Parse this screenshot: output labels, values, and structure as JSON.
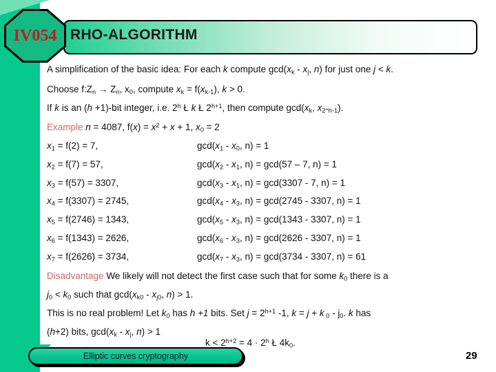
{
  "slide": {
    "course_code": "IV054",
    "title": "RHO-ALGORITHM",
    "page_number": "29",
    "footer_label": "Elliptic curves cryptography",
    "accent_green": "#05c98c",
    "highlight_red": "#c46a6a",
    "code_red": "#cc1a1a"
  },
  "intro": {
    "line1_a": "A simplification of the basic idea: For each ",
    "line1_k": "k",
    "line1_b": " compute gcd(",
    "line1_x": "x",
    "line1_xk_sub": "k",
    "line1_c": " - ",
    "line1_xj": "x",
    "line1_xj_sub": "j",
    "line1_d": ", ",
    "line1_n": "n",
    "line1_e": ") for just one ",
    "line1_j": "j",
    "line1_f": " < ",
    "line1_g": "k",
    "line1_h": "."
  },
  "setup": {
    "line1": "Choose f:Z",
    "line1_sub1": "n",
    "line1_arrow": " → Z",
    "line1_sub2": "n",
    "line1_b": ", x",
    "line1_sub3": "0",
    "line1_c": ", compute ",
    "line1_xk": "x",
    "line1_sub4": "k",
    "line1_d": " = f(",
    "line1_xk1": "x",
    "line1_sub5": "k-1",
    "line1_e": "), ",
    "line1_kk": "k",
    "line1_f": " > 0.",
    "line2_a": "If ",
    "line2_k": "k",
    "line2_b": " is an (",
    "line2_h": "h",
    "line2_c": " +1)-bit integer, i.e. 2",
    "line2_sup1": "h",
    "line2_le1": " Ł ",
    "line2_k2": "k",
    "line2_le2": " Ł ",
    "line2_d": " 2",
    "line2_sup2": "h+1",
    "line2_e": ", then compute gcd(",
    "line2_xk": "x",
    "line2_subk": "k",
    "line2_f": ", ",
    "line2_x2": "x",
    "line2_sub2h": "2^h-1",
    "line2_g": ")."
  },
  "example": {
    "label": "Example",
    "header_a": " n",
    "header_b": " = 4087, f(",
    "header_x": "x",
    "header_c": ") = ",
    "header_x2": "x",
    "header_sup": "2",
    "header_d": " + ",
    "header_x3": "x",
    "header_e": " + 1, ",
    "header_x0": "x",
    "header_sub0": "0",
    "header_f": " = 2",
    "rows": [
      {
        "left_var": "x",
        "left_sub": "1",
        "left_rest": " = f(2) = 7,",
        "right_pre": "gcd(",
        "right_x1": "x",
        "right_sub1": "1",
        "right_mid": " - ",
        "right_x2": "x",
        "right_sub2": "0",
        "right_post": ", n) = 1"
      },
      {
        "left_var": "x",
        "left_sub": "2",
        "left_rest": " = f(7) = 57,",
        "right_pre": "gcd(",
        "right_x1": "x",
        "right_sub1": "2",
        "right_mid": " - ",
        "right_x2": "x",
        "right_sub2": "1",
        "right_post": ", n) = gcd(57 – 7, n) = 1"
      },
      {
        "left_var": "x",
        "left_sub": "3",
        "left_rest": " = f(57) = 3307,",
        "right_pre": "gcd(",
        "right_x1": "x",
        "right_sub1": "3",
        "right_mid": " - ",
        "right_x2": "x",
        "right_sub2": "1",
        "right_post": ", n) = gcd(3307 - 7, n) = 1"
      },
      {
        "left_var": "x",
        "left_sub": "4",
        "left_rest": " = f(3307) = 2745,",
        "right_pre": "gcd(",
        "right_x1": "x",
        "right_sub1": "4",
        "right_mid": " - ",
        "right_x2": "x",
        "right_sub2": "3",
        "right_post": ", n) = gcd(2745 - 3307, n) = 1"
      },
      {
        "left_var": "x",
        "left_sub": "5",
        "left_rest": " = f(2746) = 1343,",
        "right_pre": "gcd(",
        "right_x1": "x",
        "right_sub1": "5",
        "right_mid": " - ",
        "right_x2": "x",
        "right_sub2": "3",
        "right_post": ", n) = gcd(1343 - 3307, n) = 1"
      },
      {
        "left_var": "x",
        "left_sub": "6",
        "left_rest": " = f(1343) = 2626,",
        "right_pre": "gcd(",
        "right_x1": "x",
        "right_sub1": "6",
        "right_mid": " - ",
        "right_x2": "x",
        "right_sub2": "3",
        "right_post": ", n) = gcd(2626 - 3307, n) = 1"
      },
      {
        "left_var": "x",
        "left_sub": "7",
        "left_rest": " = f(2626) = 3734,",
        "right_pre": "gcd(",
        "right_x1": "x",
        "right_sub1": "7",
        "right_mid": " - ",
        "right_x2": "x",
        "right_sub2": "3",
        "right_post": ", n) = gcd(3734 - 3307, n) = 61"
      }
    ]
  },
  "disadvantage": {
    "label": "Disadvantage",
    "l1_a": " We likely will not detect the first case such that for some ",
    "l1_k": "k",
    "l1_sub": "0",
    "l1_b": " there is a",
    "l2_j": "j",
    "l2_sub1": "0",
    "l2_a": " < ",
    "l2_k": "k",
    "l2_sub2": "0",
    "l2_b": " such that gcd(",
    "l2_x1": "x",
    "l2_subx1": "k0",
    "l2_c": " - ",
    "l2_x2": "x",
    "l2_subx2": "j0",
    "l2_d": ", ",
    "l2_n": "n",
    "l2_e": ") > 1.",
    "l3_a": "This is no real problem! Let ",
    "l3_k": "k",
    "l3_sub": "0",
    "l3_b": " has ",
    "l3_h": "h +1",
    "l3_c": " bits. Set ",
    "l3_j": "j",
    "l3_d": " = 2",
    "l3_sup": "h+1",
    "l3_e": " -1, ",
    "l3_k2": "k",
    "l3_f": " = ",
    "l3_j2": "j",
    "l3_g": " + ",
    "l3_k3": "k",
    "l3_sub3": " 0",
    "l3_h2": " - j",
    "l3_sub4": "0",
    "l3_i": ". ",
    "l3_k4": "k",
    "l3_j3": " has",
    "l4_a": "(",
    "l4_h": "h",
    "l4_b": "+2) bits, gcd(",
    "l4_x1": "x",
    "l4_sub1": "k",
    "l4_c": " - ",
    "l4_x2": "x",
    "l4_sub2": "j",
    "l4_d": ", ",
    "l4_n": "n",
    "l4_e": ") > 1",
    "final_a": "k",
    "final_b": " < 2",
    "final_sup1": "h+2",
    "final_c": " = 4 · 2",
    "final_sup2": "h",
    "final_le": " Ł ",
    "final_d": "4k",
    "final_sub": "0",
    "final_e": "."
  }
}
